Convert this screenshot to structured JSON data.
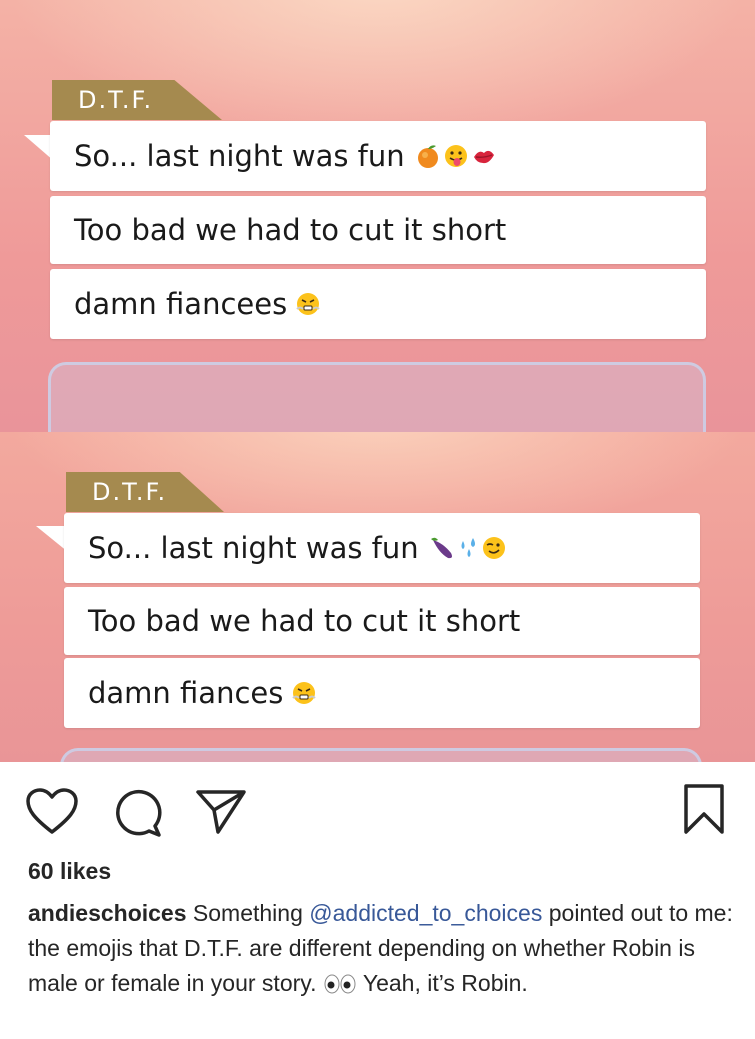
{
  "screens": [
    {
      "speaker": "D.T.F.",
      "messages": [
        {
          "text": "So... last night was fun",
          "emojis": [
            "peach-emoji",
            "tongue-out-face-emoji",
            "kiss-lips-emoji"
          ]
        },
        {
          "text": "Too bad we had to cut it short",
          "emojis": []
        },
        {
          "text": "damn fiancees",
          "emojis": [
            "steam-face-emoji"
          ]
        }
      ]
    },
    {
      "speaker": "D.T.F.",
      "messages": [
        {
          "text": "So... last night was fun",
          "emojis": [
            "eggplant-emoji",
            "sweat-droplets-emoji",
            "winking-face-emoji"
          ]
        },
        {
          "text": "Too bad we had to cut it short",
          "emojis": []
        },
        {
          "text": "damn fiances",
          "emojis": [
            "steam-face-emoji"
          ]
        }
      ]
    }
  ],
  "post": {
    "likes": "60 likes",
    "username": "andieschoices",
    "caption_before": " Something ",
    "mention": "@addicted_to_choices",
    "caption_after": " pointed out to me: the emojis that D.T.F. are different depending on whether Robin is male or female in your story.",
    "caption_eyes": "eyes-emoji",
    "caption_end": " Yeah, it’s Robin."
  },
  "colors": {
    "name_tag": "#a58a4f",
    "text": "#262626",
    "mention": "#385898"
  }
}
